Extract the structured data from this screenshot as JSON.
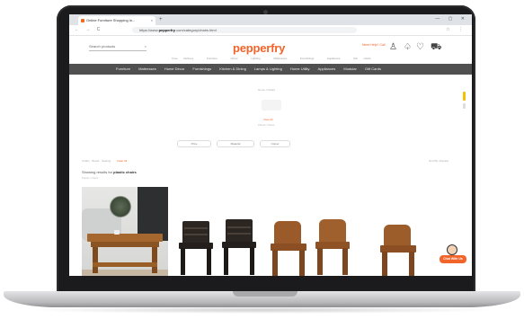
{
  "browser": {
    "tab_title": "Online Furniture Shopping in...",
    "tab_close": "×",
    "new_tab": "+",
    "window_controls": "— ▢ ✕",
    "nav_buttons": "← → C",
    "url_prefix": "https://www.",
    "url_domain": "pepperfry",
    "url_suffix": ".com/category/chairs.html",
    "toolbar_icons": "☆ ⋮"
  },
  "site": {
    "search_placeholder": "Search products",
    "logo": "pepperfry",
    "help_text": "Need Help? Call",
    "subnav": "Free Delivery · Furniture · Decor · Lighting · Mattresses · Furnishings · Appliances · Gift Cards"
  },
  "categories": [
    "Furniture",
    "Mattresses",
    "Home Décor",
    "Furnishings",
    "Kitchen & Dining",
    "Lamps & Lighting",
    "Home Utility",
    "Appliances",
    "Modular",
    "Gift Cards"
  ],
  "page": {
    "breadcrumb": "Home / Chairs",
    "center_link": "View All",
    "center_sub": "Plastic Chairs",
    "filters": [
      "Price",
      "Material",
      "Colour"
    ],
    "sort_left": "Chairs  ·  Brand  ·  Seating",
    "sort_highlight": "Clear All",
    "sort_right": "Sort By: Popular",
    "results_prefix": "Showing results for",
    "results_term": "plastic chairs",
    "results_sub": "Plastic Chairs"
  },
  "help_badge": "Chat With Us",
  "colors": {
    "brand": "#f3642a",
    "catbar": "#505050",
    "chair_dark": "#2b2622",
    "chair_wood": "#9a5a2a"
  }
}
